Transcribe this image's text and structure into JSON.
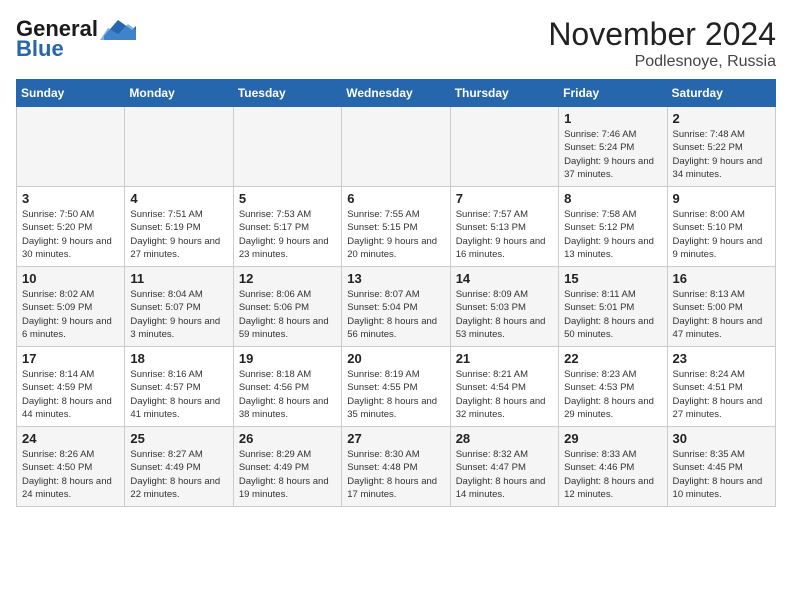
{
  "header": {
    "logo_general": "General",
    "logo_blue": "Blue",
    "month": "November 2024",
    "location": "Podlesnoye, Russia"
  },
  "days_of_week": [
    "Sunday",
    "Monday",
    "Tuesday",
    "Wednesday",
    "Thursday",
    "Friday",
    "Saturday"
  ],
  "weeks": [
    [
      {
        "day": "",
        "info": ""
      },
      {
        "day": "",
        "info": ""
      },
      {
        "day": "",
        "info": ""
      },
      {
        "day": "",
        "info": ""
      },
      {
        "day": "",
        "info": ""
      },
      {
        "day": "1",
        "info": "Sunrise: 7:46 AM\nSunset: 5:24 PM\nDaylight: 9 hours and 37 minutes."
      },
      {
        "day": "2",
        "info": "Sunrise: 7:48 AM\nSunset: 5:22 PM\nDaylight: 9 hours and 34 minutes."
      }
    ],
    [
      {
        "day": "3",
        "info": "Sunrise: 7:50 AM\nSunset: 5:20 PM\nDaylight: 9 hours and 30 minutes."
      },
      {
        "day": "4",
        "info": "Sunrise: 7:51 AM\nSunset: 5:19 PM\nDaylight: 9 hours and 27 minutes."
      },
      {
        "day": "5",
        "info": "Sunrise: 7:53 AM\nSunset: 5:17 PM\nDaylight: 9 hours and 23 minutes."
      },
      {
        "day": "6",
        "info": "Sunrise: 7:55 AM\nSunset: 5:15 PM\nDaylight: 9 hours and 20 minutes."
      },
      {
        "day": "7",
        "info": "Sunrise: 7:57 AM\nSunset: 5:13 PM\nDaylight: 9 hours and 16 minutes."
      },
      {
        "day": "8",
        "info": "Sunrise: 7:58 AM\nSunset: 5:12 PM\nDaylight: 9 hours and 13 minutes."
      },
      {
        "day": "9",
        "info": "Sunrise: 8:00 AM\nSunset: 5:10 PM\nDaylight: 9 hours and 9 minutes."
      }
    ],
    [
      {
        "day": "10",
        "info": "Sunrise: 8:02 AM\nSunset: 5:09 PM\nDaylight: 9 hours and 6 minutes."
      },
      {
        "day": "11",
        "info": "Sunrise: 8:04 AM\nSunset: 5:07 PM\nDaylight: 9 hours and 3 minutes."
      },
      {
        "day": "12",
        "info": "Sunrise: 8:06 AM\nSunset: 5:06 PM\nDaylight: 8 hours and 59 minutes."
      },
      {
        "day": "13",
        "info": "Sunrise: 8:07 AM\nSunset: 5:04 PM\nDaylight: 8 hours and 56 minutes."
      },
      {
        "day": "14",
        "info": "Sunrise: 8:09 AM\nSunset: 5:03 PM\nDaylight: 8 hours and 53 minutes."
      },
      {
        "day": "15",
        "info": "Sunrise: 8:11 AM\nSunset: 5:01 PM\nDaylight: 8 hours and 50 minutes."
      },
      {
        "day": "16",
        "info": "Sunrise: 8:13 AM\nSunset: 5:00 PM\nDaylight: 8 hours and 47 minutes."
      }
    ],
    [
      {
        "day": "17",
        "info": "Sunrise: 8:14 AM\nSunset: 4:59 PM\nDaylight: 8 hours and 44 minutes."
      },
      {
        "day": "18",
        "info": "Sunrise: 8:16 AM\nSunset: 4:57 PM\nDaylight: 8 hours and 41 minutes."
      },
      {
        "day": "19",
        "info": "Sunrise: 8:18 AM\nSunset: 4:56 PM\nDaylight: 8 hours and 38 minutes."
      },
      {
        "day": "20",
        "info": "Sunrise: 8:19 AM\nSunset: 4:55 PM\nDaylight: 8 hours and 35 minutes."
      },
      {
        "day": "21",
        "info": "Sunrise: 8:21 AM\nSunset: 4:54 PM\nDaylight: 8 hours and 32 minutes."
      },
      {
        "day": "22",
        "info": "Sunrise: 8:23 AM\nSunset: 4:53 PM\nDaylight: 8 hours and 29 minutes."
      },
      {
        "day": "23",
        "info": "Sunrise: 8:24 AM\nSunset: 4:51 PM\nDaylight: 8 hours and 27 minutes."
      }
    ],
    [
      {
        "day": "24",
        "info": "Sunrise: 8:26 AM\nSunset: 4:50 PM\nDaylight: 8 hours and 24 minutes."
      },
      {
        "day": "25",
        "info": "Sunrise: 8:27 AM\nSunset: 4:49 PM\nDaylight: 8 hours and 22 minutes."
      },
      {
        "day": "26",
        "info": "Sunrise: 8:29 AM\nSunset: 4:49 PM\nDaylight: 8 hours and 19 minutes."
      },
      {
        "day": "27",
        "info": "Sunrise: 8:30 AM\nSunset: 4:48 PM\nDaylight: 8 hours and 17 minutes."
      },
      {
        "day": "28",
        "info": "Sunrise: 8:32 AM\nSunset: 4:47 PM\nDaylight: 8 hours and 14 minutes."
      },
      {
        "day": "29",
        "info": "Sunrise: 8:33 AM\nSunset: 4:46 PM\nDaylight: 8 hours and 12 minutes."
      },
      {
        "day": "30",
        "info": "Sunrise: 8:35 AM\nSunset: 4:45 PM\nDaylight: 8 hours and 10 minutes."
      }
    ]
  ]
}
